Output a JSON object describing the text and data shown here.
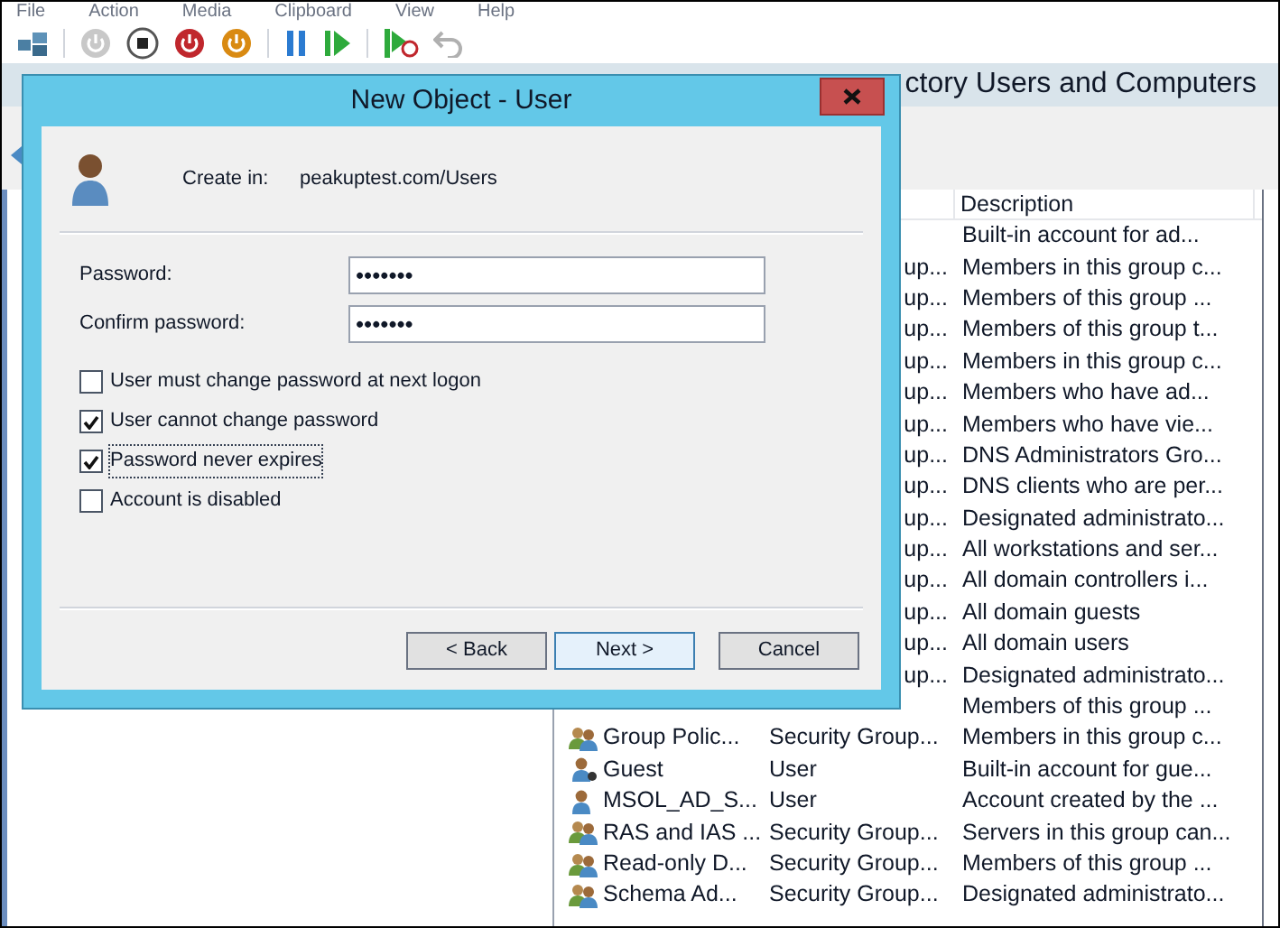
{
  "menu": [
    "File",
    "Action",
    "Media",
    "Clipboard",
    "View",
    "Help"
  ],
  "background_window": {
    "title": "ctory Users and Computers"
  },
  "list": {
    "columns": [
      "Description"
    ],
    "rows": [
      {
        "description": "Built-in account for ad..."
      },
      {
        "type": "up...",
        "description": "Members in this group c..."
      },
      {
        "type": "up...",
        "description": "Members of this group ..."
      },
      {
        "type": "up...",
        "description": "Members of this group t..."
      },
      {
        "type": "up...",
        "description": "Members in this group c..."
      },
      {
        "type": "up...",
        "description": "Members who have ad..."
      },
      {
        "type": "up...",
        "description": "Members who have vie..."
      },
      {
        "type": "up...",
        "description": "DNS Administrators Gro..."
      },
      {
        "type": "up...",
        "description": "DNS clients who are per..."
      },
      {
        "type": "up...",
        "description": "Designated administrato..."
      },
      {
        "type": "up...",
        "description": "All workstations and ser..."
      },
      {
        "type": "up...",
        "description": "All domain controllers i..."
      },
      {
        "type": "up...",
        "description": "All domain guests"
      },
      {
        "type": "up...",
        "description": "All domain users"
      },
      {
        "type": "up...",
        "description": "Designated administrato..."
      },
      {
        "description": "Members of this group ..."
      },
      {
        "kind": "group",
        "name": "Group Polic...",
        "type": "Security Group...",
        "description": "Members in this group c..."
      },
      {
        "kind": "guest",
        "name": "Guest",
        "type": "User",
        "description": "Built-in account for gue..."
      },
      {
        "kind": "user",
        "name": "MSOL_AD_S...",
        "type": "User",
        "description": "Account created by the ..."
      },
      {
        "kind": "group",
        "name": "RAS and IAS ...",
        "type": "Security Group...",
        "description": "Servers in this group can..."
      },
      {
        "kind": "group",
        "name": "Read-only D...",
        "type": "Security Group...",
        "description": "Members of this group ..."
      },
      {
        "kind": "group",
        "name": "Schema Ad...",
        "type": "Security Group...",
        "description": "Designated administrato..."
      }
    ]
  },
  "dialog": {
    "title": "New Object - User",
    "create_in_label": "Create in:",
    "create_in_value": "peakuptest.com/Users",
    "fields": [
      {
        "label": "Password:",
        "value": "•••••••"
      },
      {
        "label": "Confirm password:",
        "value": "•••••••"
      }
    ],
    "options": [
      {
        "label": "User must change password at next logon",
        "checked": false,
        "focused": false
      },
      {
        "label": "User cannot change password",
        "checked": true,
        "focused": false
      },
      {
        "label": "Password never expires",
        "checked": true,
        "focused": true
      },
      {
        "label": "Account is disabled",
        "checked": false,
        "focused": false
      }
    ],
    "buttons": [
      {
        "label": "< Back",
        "default": false
      },
      {
        "label": "Next >",
        "default": true
      },
      {
        "label": "Cancel",
        "default": false
      }
    ]
  }
}
